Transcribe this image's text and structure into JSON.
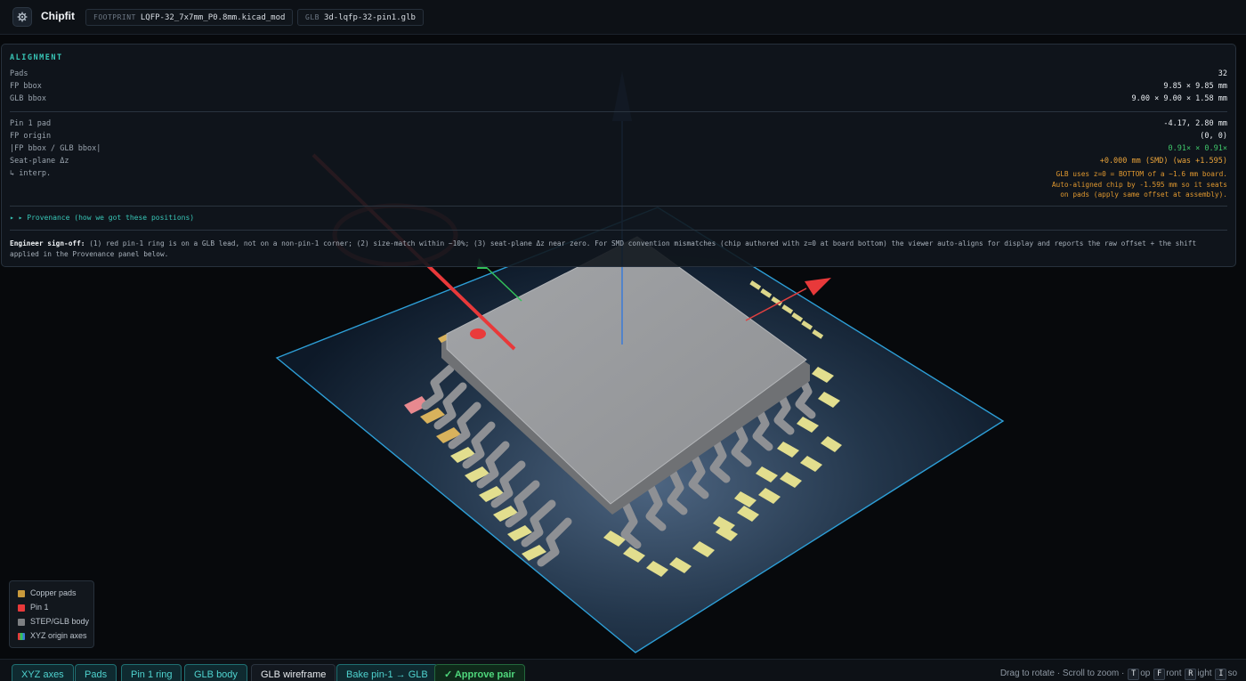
{
  "app": {
    "title": "Chipfit",
    "logo_icon": "gear-icon"
  },
  "header": {
    "footprint": {
      "key": "FOOTPRINT",
      "value": "LQFP-32_7x7mm_P0.8mm.kicad_mod"
    },
    "glb": {
      "key": "GLB",
      "value": "3d-lqfp-32-pin1.glb"
    }
  },
  "alignment": {
    "title": "ALIGNMENT",
    "rows_top": [
      {
        "label": "Pads",
        "value": "32"
      },
      {
        "label": "FP bbox",
        "value": "9.85 × 9.85 mm"
      },
      {
        "label": "GLB bbox",
        "value": "9.00 × 9.00 × 1.58 mm"
      }
    ],
    "rows_bottom": [
      {
        "label": "Pin 1 pad",
        "value": "-4.17, 2.80 mm",
        "color": "default"
      },
      {
        "label": "FP origin",
        "value": "(0, 0)",
        "color": "default"
      },
      {
        "label": "|FP bbox / GLB bbox|",
        "value": "0.91× × 0.91×",
        "color": "green"
      },
      {
        "label": "Seat-plane Δz",
        "value": "+0.000 mm (SMD) (was +1.595)",
        "color": "orange"
      },
      {
        "label": "↳ interp.",
        "value": "",
        "color": "default"
      }
    ],
    "note_lines": [
      "GLB uses z=0 = BOTTOM of a ~1.6 mm board.",
      "Auto-aligned chip by -1.595 mm so it seats",
      "on pads (apply same offset at assembly)."
    ],
    "provenance_label": "▸ ▸ Provenance (how we got these positions)",
    "signoff_title": "Engineer sign-off:",
    "signoff_text": " (1) red pin-1 ring is on a GLB lead, not on a non-pin-1 corner; (2) size-match within ~10%; (3) seat-plane Δz near zero. For SMD convention mismatches (chip authored with z=0 at board bottom) the viewer auto-aligns for display and reports the raw offset + the shift applied in the Provenance panel below."
  },
  "colors": {
    "accent": "#38c6b7",
    "green": "#3fc56a",
    "orange": "#e8a23a",
    "copper": "#c99a3c",
    "pin1": "#e8393a",
    "body": "#7d7f82"
  },
  "legend": [
    {
      "label": "Copper pads",
      "color": "#c99a3c"
    },
    {
      "label": "Pin 1",
      "color": "#e8393a"
    },
    {
      "label": "STEP/GLB body",
      "color": "#7d7f82"
    },
    {
      "label": "XYZ origin axes",
      "color": "axes"
    }
  ],
  "toolbar": {
    "buttons": [
      {
        "label": "XYZ axes",
        "state": "on"
      },
      {
        "label": "Pads",
        "state": "on"
      },
      {
        "label": "Pin 1 ring",
        "state": "on"
      },
      {
        "label": "GLB body",
        "state": "on"
      },
      {
        "label": "GLB wireframe",
        "state": "off"
      },
      {
        "label": "Bake pin-1 → GLB",
        "state": "on"
      },
      {
        "label": "✓ Approve pair",
        "state": "approve"
      }
    ],
    "hint_prefix": "Drag to rotate · Scroll to zoom · ",
    "keys": [
      {
        "key": "T",
        "rest": "op"
      },
      {
        "key": "F",
        "rest": "ront"
      },
      {
        "key": "R",
        "rest": "ight"
      },
      {
        "key": "I",
        "rest": "so"
      }
    ]
  }
}
